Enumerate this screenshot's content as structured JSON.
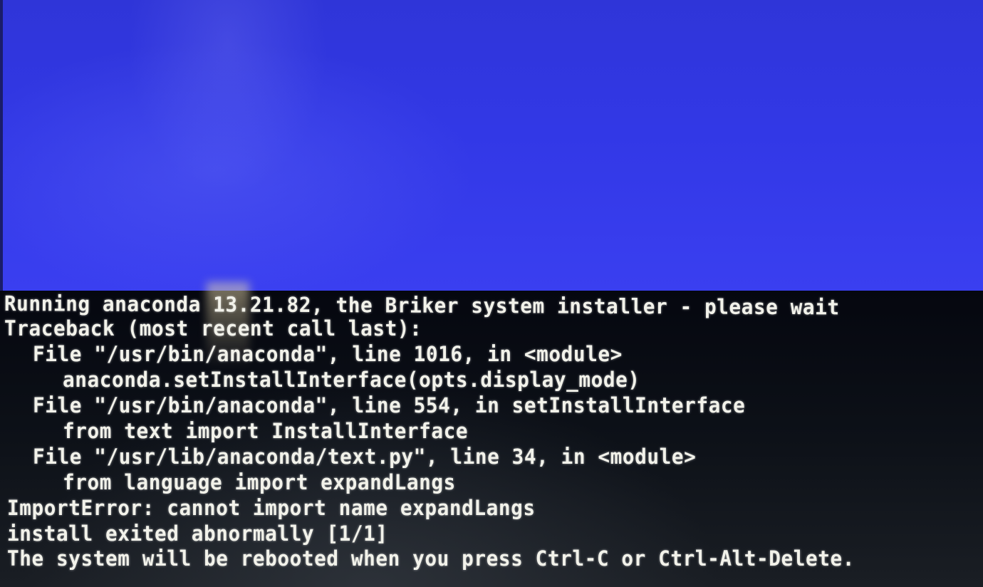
{
  "screen": {
    "background_top_color": "#3238e6",
    "background_bottom_color": "#0d1118",
    "text_color": "#f2f2ea"
  },
  "console": {
    "lines": [
      "Running anaconda 13.21.82, the Briker system installer - please wait",
      "Traceback (most recent call last):",
      "File \"/usr/bin/anaconda\", line 1016, in <module>",
      "anaconda.setInstallInterface(opts.display_mode)",
      "File \"/usr/bin/anaconda\", line 554, in setInstallInterface",
      "from text import InstallInterface",
      "File \"/usr/lib/anaconda/text.py\", line 34, in <module>",
      "from language import expandLangs",
      "ImportError: cannot import name expandLangs",
      "install exited abnormally [1/1]",
      "The system will be rebooted when you press Ctrl-C or Ctrl-Alt-Delete."
    ]
  }
}
